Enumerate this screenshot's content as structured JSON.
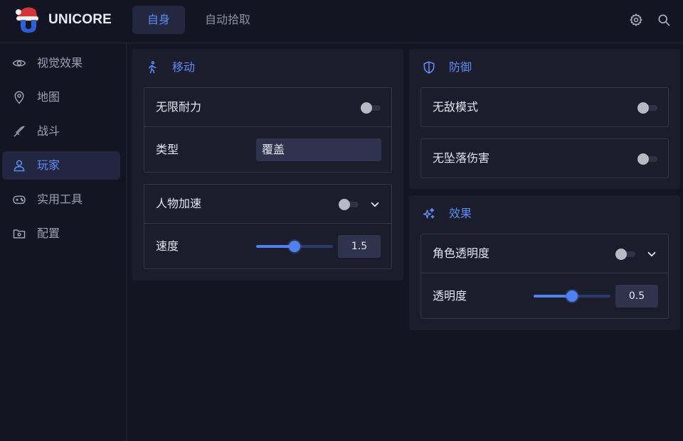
{
  "app": {
    "brand": "UNICORE"
  },
  "header": {
    "tabs": [
      {
        "label": "自身",
        "active": true
      },
      {
        "label": "自动拾取",
        "active": false
      }
    ],
    "icons": [
      "gear-icon",
      "search-icon"
    ]
  },
  "sidebar": {
    "items": [
      {
        "label": "视觉效果",
        "icon": "eye-icon",
        "active": false
      },
      {
        "label": "地图",
        "icon": "map-pin-icon",
        "active": false
      },
      {
        "label": "战斗",
        "icon": "sword-icon",
        "active": false
      },
      {
        "label": "玩家",
        "icon": "user-icon",
        "active": true
      },
      {
        "label": "实用工具",
        "icon": "gamepad-icon",
        "active": false
      },
      {
        "label": "配置",
        "icon": "folder-gear-icon",
        "active": false
      }
    ]
  },
  "sections": {
    "movement": {
      "title": "移动",
      "icon": "walking-icon",
      "infinite_stamina": {
        "label": "无限耐力",
        "enabled": false,
        "type_label": "类型",
        "type_value": "覆盖"
      },
      "speed_hack": {
        "label": "人物加速",
        "enabled": false,
        "speed_label": "速度",
        "speed_value": "1.5",
        "speed_fraction": 0.5
      }
    },
    "defense": {
      "title": "防御",
      "icon": "shield-icon",
      "god_mode": {
        "label": "无敌模式",
        "enabled": false
      },
      "no_fall_damage": {
        "label": "无坠落伤害",
        "enabled": false
      }
    },
    "effects": {
      "title": "效果",
      "icon": "sparkles-icon",
      "char_transparency": {
        "label": "角色透明度",
        "enabled": false,
        "opacity_label": "透明度",
        "opacity_value": "0.5",
        "opacity_fraction": 0.5
      }
    }
  },
  "colors": {
    "background": "#141522",
    "panel": "#1b1c2c",
    "accent": "#5b8cf5",
    "border": "#34364c",
    "input": "#30334d"
  }
}
